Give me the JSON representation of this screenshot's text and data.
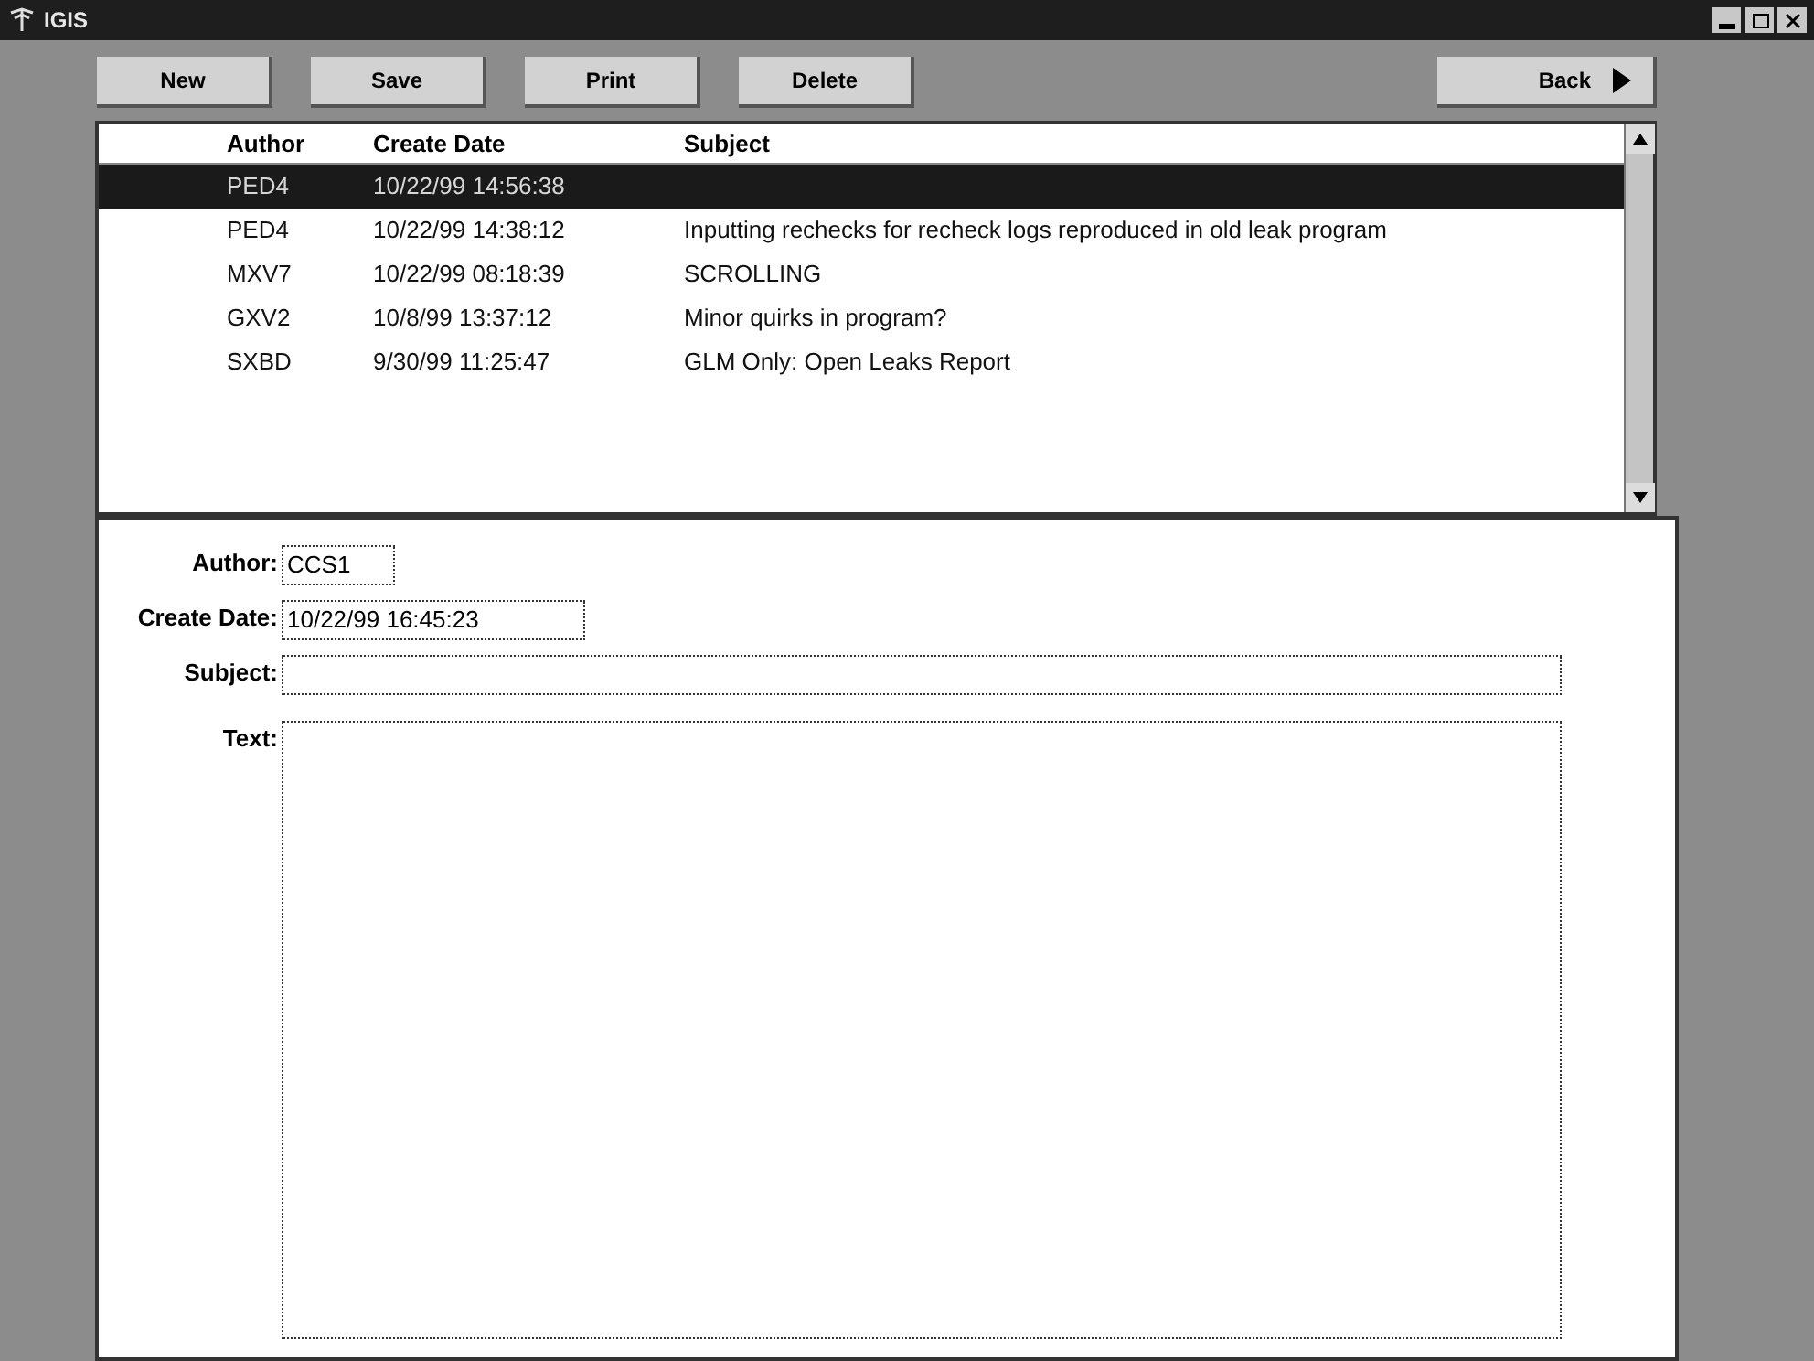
{
  "window": {
    "title": "IGIS"
  },
  "toolbar": {
    "buttons": [
      "New",
      "Save",
      "Print",
      "Delete"
    ],
    "back": "Back"
  },
  "list": {
    "columns": [
      "Author",
      "Create Date",
      "Subject"
    ],
    "rows": [
      {
        "author": "PED4",
        "date": "10/22/99 14:56:38",
        "subject": "",
        "selected": true
      },
      {
        "author": "PED4",
        "date": "10/22/99 14:38:12",
        "subject": "Inputting rechecks for recheck logs reproduced in old leak program",
        "selected": false
      },
      {
        "author": "MXV7",
        "date": "10/22/99 08:18:39",
        "subject": "SCROLLING",
        "selected": false
      },
      {
        "author": "GXV2",
        "date": "10/8/99 13:37:12",
        "subject": "Minor quirks in program?",
        "selected": false
      },
      {
        "author": "SXBD",
        "date": "9/30/99 11:25:47",
        "subject": "GLM Only: Open Leaks Report",
        "selected": false
      }
    ]
  },
  "form": {
    "author": {
      "label": "Author:",
      "value": "CCS1"
    },
    "create_date": {
      "label": "Create Date:",
      "value": "10/22/99 16:45:23"
    },
    "subject": {
      "label": "Subject:"
    },
    "text": {
      "label": "Text:"
    }
  }
}
